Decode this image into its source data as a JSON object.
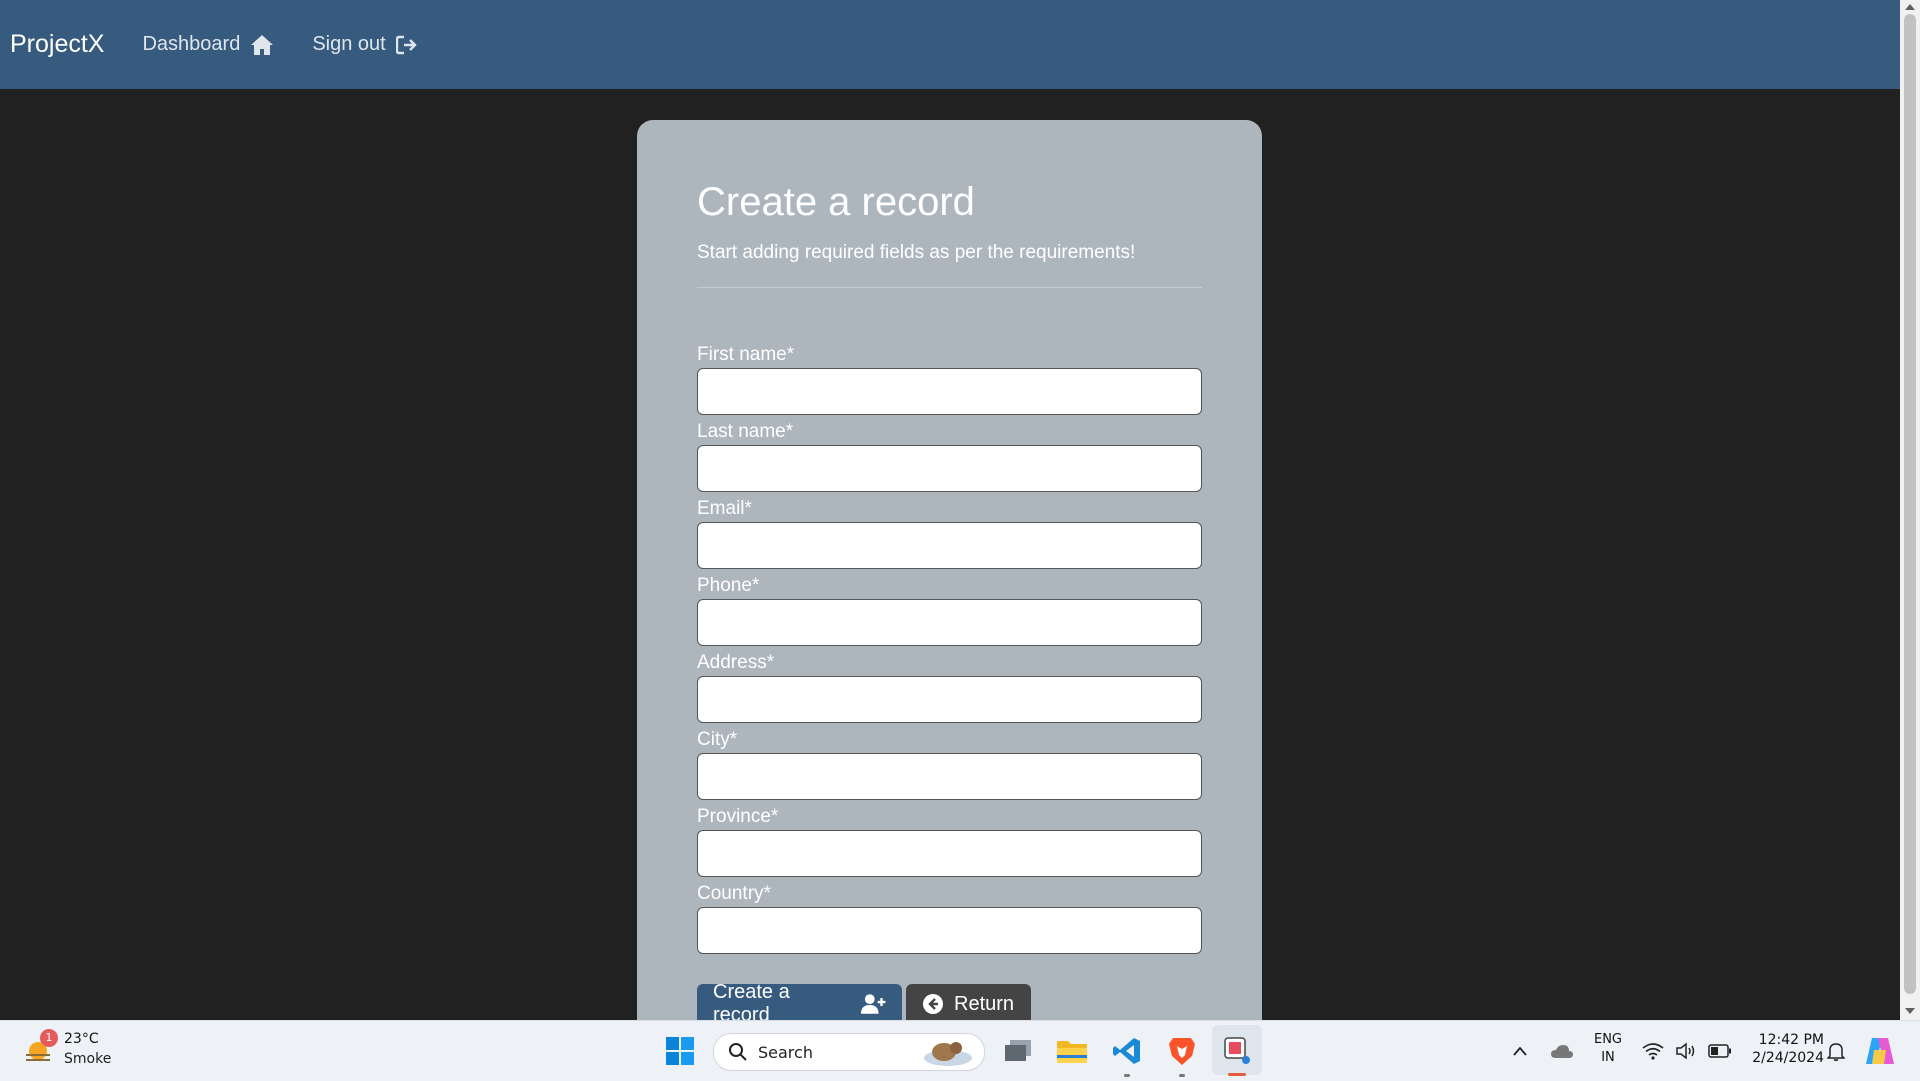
{
  "navbar": {
    "brand": "ProjectX",
    "links": [
      {
        "label": "Dashboard",
        "icon": "home-icon"
      },
      {
        "label": "Sign out",
        "icon": "sign-out-icon"
      }
    ]
  },
  "form": {
    "title": "Create a record",
    "subtitle": "Start adding required fields as per the requirements!",
    "fields": [
      {
        "label": "First name*",
        "value": ""
      },
      {
        "label": "Last name*",
        "value": ""
      },
      {
        "label": "Email*",
        "value": ""
      },
      {
        "label": "Phone*",
        "value": ""
      },
      {
        "label": "Address*",
        "value": ""
      },
      {
        "label": "City*",
        "value": ""
      },
      {
        "label": "Province*",
        "value": ""
      },
      {
        "label": "Country*",
        "value": ""
      }
    ],
    "submit_label": "Create a record",
    "return_label": "Return"
  },
  "taskbar": {
    "weather_badge": "1",
    "weather_temp": "23°C",
    "weather_desc": "Smoke",
    "search_label": "Search",
    "lang_line1": "ENG",
    "lang_line2": "IN",
    "time": "12:42 PM",
    "date": "2/24/2024"
  },
  "colors": {
    "navbar": "#375a7f",
    "background": "#212121",
    "card": "#adb5bd",
    "primary_button": "#375a7f",
    "secondary_button": "#444444"
  }
}
